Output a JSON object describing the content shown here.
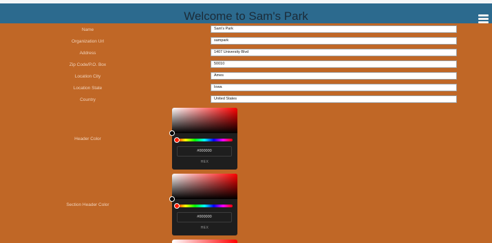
{
  "header": {
    "title": "Welcome to Sam's Park",
    "menu_icon": "hamburger-menu-icon"
  },
  "fields": [
    {
      "label": "Name",
      "value": "Sam's Park"
    },
    {
      "label": "Organization Url",
      "value": "sampark"
    },
    {
      "label": "Address",
      "value": "1407 University Blvd"
    },
    {
      "label": "Zip Code/P.O. Box",
      "value": "50010"
    },
    {
      "label": "Location City",
      "value": "Ames"
    },
    {
      "label": "Location State",
      "value": "Iowa"
    },
    {
      "label": "Country",
      "value": "United States"
    }
  ],
  "color_pickers": [
    {
      "label": "Header Color",
      "hex_value": "#000000",
      "format_label": "HEX"
    },
    {
      "label": "Section Header Color",
      "hex_value": "#000000",
      "format_label": "HEX"
    }
  ],
  "colors": {
    "page_background": "#c06726",
    "header_bar": "#2c6a8e",
    "picker_background": "#1e1e1e"
  }
}
